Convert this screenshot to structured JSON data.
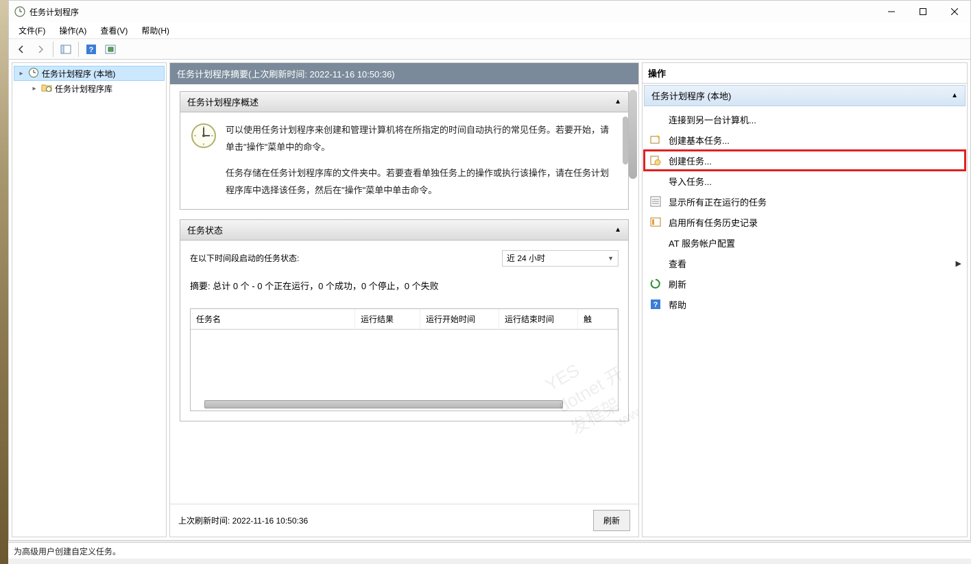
{
  "window": {
    "title": "任务计划程序"
  },
  "menubar": {
    "file": "文件(F)",
    "action": "操作(A)",
    "view": "查看(V)",
    "help": "帮助(H)"
  },
  "tree": {
    "root": "任务计划程序 (本地)",
    "library": "任务计划程序库"
  },
  "summary": {
    "header": "任务计划程序摘要(上次刷新时间: 2022-11-16 10:50:36)",
    "overview_title": "任务计划程序概述",
    "overview_p1": "可以使用任务计划程序来创建和管理计算机将在所指定的时间自动执行的常见任务。若要开始，请单击\"操作\"菜单中的命令。",
    "overview_p2": "任务存储在任务计划程序库的文件夹中。若要查看单独任务上的操作或执行该操作，请在任务计划程序库中选择该任务，然后在\"操作\"菜单中单击命令。",
    "status_title": "任务状态",
    "status_period_label": "在以下时间段启动的任务状态:",
    "status_period_value": "近 24 小时",
    "status_summary": "摘要: 总计 0 个 - 0 个正在运行，0 个成功，0 个停止，0 个失败",
    "table_cols": {
      "c1": "任务名",
      "c2": "运行结果",
      "c3": "运行开始时间",
      "c4": "运行结束时间",
      "c5": "触"
    },
    "last_refresh_label": "上次刷新时间: 2022-11-16 10:50:36",
    "refresh_btn": "刷新"
  },
  "actions": {
    "panel_title": "操作",
    "section_title": "任务计划程序 (本地)",
    "items": {
      "connect": "连接到另一台计算机...",
      "create_basic": "创建基本任务...",
      "create_task": "创建任务...",
      "import_task": "导入任务...",
      "show_running": "显示所有正在运行的任务",
      "enable_history": "启用所有任务历史记录",
      "at_config": "AT 服务帐户配置",
      "view": "查看",
      "refresh": "刷新",
      "help": "帮助"
    }
  },
  "statusbar": {
    "text": "为高级用户创建自定义任务。"
  }
}
